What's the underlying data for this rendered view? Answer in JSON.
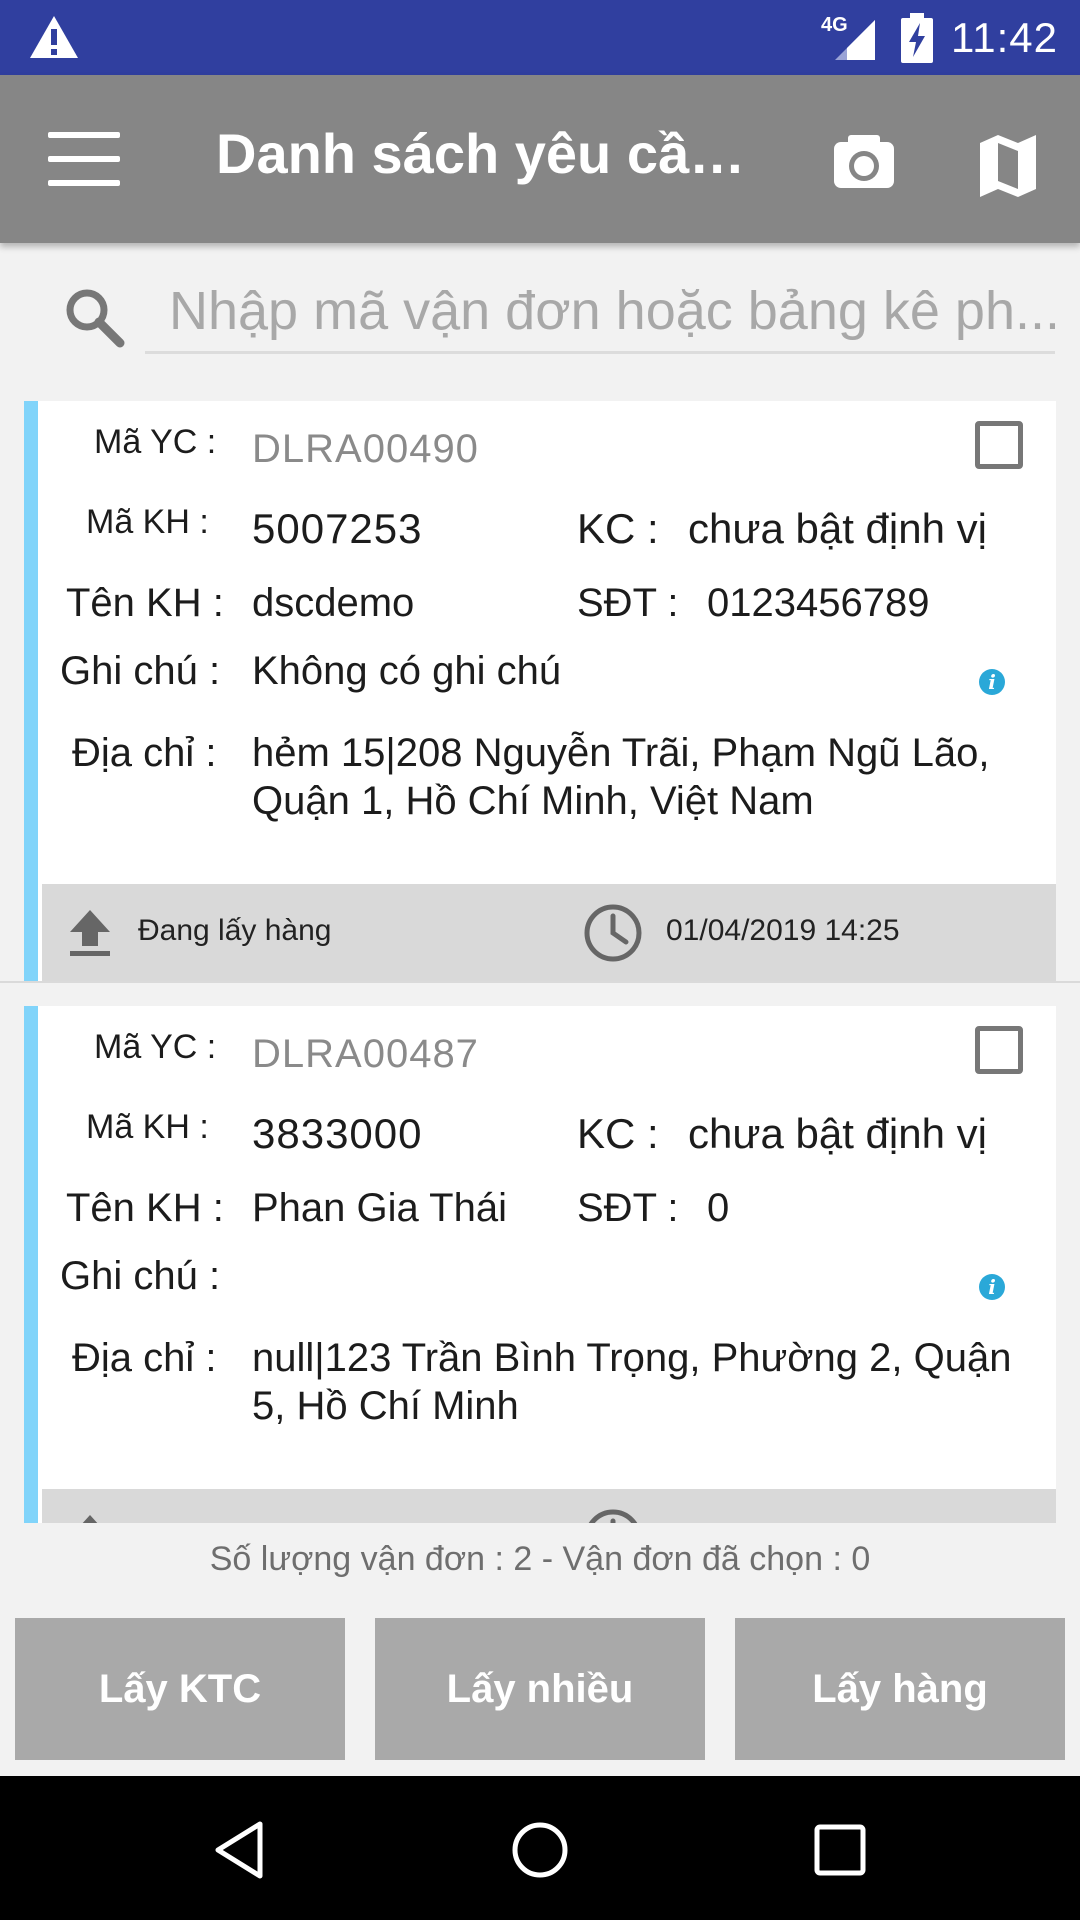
{
  "status_bar": {
    "network": "4G",
    "time": "11:42"
  },
  "toolbar": {
    "title": "Danh sách yêu cầu...",
    "menu_icon": "menu-icon",
    "camera_icon": "camera-icon",
    "map_icon": "map-icon"
  },
  "search": {
    "placeholder": "Nhập mã vận đơn hoặc bảng kê ph..."
  },
  "labels": {
    "ma_yc": "Mã YC :",
    "ma_kh": "Mã KH :",
    "kc": "KC :",
    "ten_kh": "Tên KH :",
    "sdt": "SĐT :",
    "ghi_chu": "Ghi chú :",
    "dia_chi": "Địa chỉ :"
  },
  "requests": [
    {
      "ma_yc": "DLRA00490",
      "ma_kh": "5007253",
      "kc": "chưa bật định vị",
      "ten_kh": "dscdemo",
      "sdt": "0123456789",
      "ghi_chu": "Không có ghi chú",
      "dia_chi_1": "hẻm 15|208 Nguyễn Trãi, Phạm Ngũ Lão,",
      "dia_chi_2": "Quận 1, Hồ Chí Minh, Việt Nam",
      "status": "Đang lấy hàng",
      "datetime": "01/04/2019 14:25"
    },
    {
      "ma_yc": "DLRA00487",
      "ma_kh": "3833000",
      "kc": "chưa bật định vị",
      "ten_kh": "Phan Gia Thái",
      "sdt": "0",
      "ghi_chu": "",
      "dia_chi_1": "null|123 Trần Bình Trọng, Phường 2, Quận",
      "dia_chi_2": "5, Hồ Chí Minh",
      "status": "",
      "datetime": ""
    }
  ],
  "summary": "Số lượng vận đơn : 2 - Vận đơn đã chọn : 0",
  "buttons": {
    "lay_ktc": "Lấy KTC",
    "lay_nhieu": "Lấy nhiều",
    "lay_hang": "Lấy hàng"
  },
  "colors": {
    "status_bar": "#303f9f",
    "toolbar": "#868686",
    "card_accent": "#81d4fa",
    "button": "#a9a9a9",
    "info": "#2aa8d8"
  }
}
